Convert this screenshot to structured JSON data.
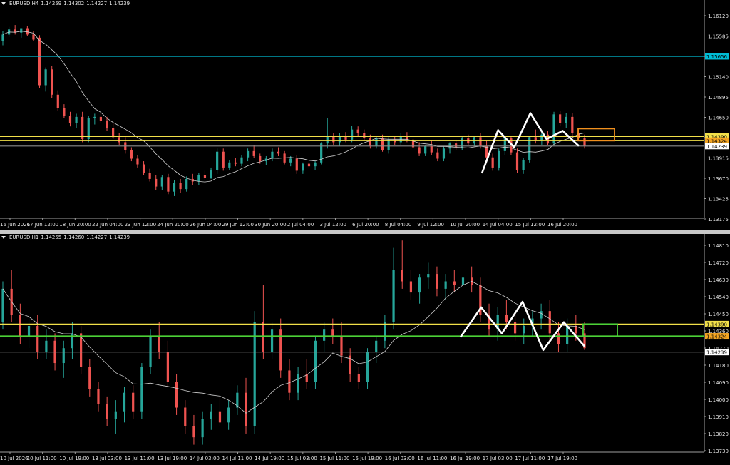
{
  "theme": {
    "background": "#000000",
    "bull": "#26a69a",
    "bear": "#ef5350",
    "ma": "#cfcfcf",
    "axis": "#9e9e9e",
    "text": "#e6e6e6"
  },
  "top": {
    "symbol": "EURUSD,H4",
    "ohlc": [
      "1.14259",
      "1.14302",
      "1.14227",
      "1.14239"
    ],
    "price_min": 1.131,
    "price_max": 1.165,
    "price_labels": [
      "1.16120",
      "1.15585",
      "1.15380",
      "1.15140",
      "1.14895",
      "1.14650",
      "1.14160",
      "1.13915",
      "1.13670",
      "1.13425",
      "1.13175"
    ],
    "time_labels": [
      "16 Jun 2026",
      "17 Jun 12:00",
      "18 Jun 20:00",
      "22 Jun 04:00",
      "23 Jun 12:00",
      "24 Jun 20:00",
      "26 Jun 04:00",
      "29 Jun 12:00",
      "30 Jun 20:00",
      "2 Jul 04:00",
      "3 Jul 12:00",
      "6 Jul 20:00",
      "8 Jul 04:00",
      "9 Jul 12:00",
      "10 Jul 20:00",
      "14 Jul 04:00",
      "15 Jul 12:00",
      "16 Jul 20:00"
    ],
    "hlines": [
      {
        "price": 1.15656,
        "color": "#00bcd4",
        "label": "1.15656",
        "tagColor": "#00bcd4"
      },
      {
        "price": 1.1439,
        "color": "#f2e04a",
        "label": "1.14390",
        "tagColor": "#f2e04a"
      },
      {
        "price": 1.14324,
        "color": "#f2e04a",
        "label": "1.14324",
        "tagColor": "#f5a623"
      },
      {
        "price": 1.14239,
        "color": "#8a8a8a",
        "label": "1.14239",
        "tagColor": "#ffffff"
      }
    ],
    "box": {
      "color": "#f0901e"
    },
    "zigzag": [
      1.1381,
      1.1449,
      1.1422,
      1.1476,
      1.1435,
      1.1448,
      1.1424
    ],
    "candles": [
      [
        1.159,
        1.1605,
        1.1583,
        1.16
      ],
      [
        1.16,
        1.1612,
        1.1596,
        1.1608
      ],
      [
        1.1608,
        1.1615,
        1.16,
        1.1603
      ],
      [
        1.1603,
        1.161,
        1.1595,
        1.161
      ],
      [
        1.161,
        1.1614,
        1.1598,
        1.16
      ],
      [
        1.16,
        1.1606,
        1.159,
        1.1592
      ],
      [
        1.1595,
        1.1599,
        1.1515,
        1.152
      ],
      [
        1.152,
        1.1548,
        1.151,
        1.1545
      ],
      [
        1.1545,
        1.155,
        1.15,
        1.1505
      ],
      [
        1.1505,
        1.1512,
        1.148,
        1.1484
      ],
      [
        1.1484,
        1.149,
        1.1468,
        1.1472
      ],
      [
        1.1472,
        1.1478,
        1.1455,
        1.146
      ],
      [
        1.146,
        1.1475,
        1.1452,
        1.147
      ],
      [
        1.147,
        1.1478,
        1.143,
        1.1435
      ],
      [
        1.1435,
        1.1472,
        1.143,
        1.1468
      ],
      [
        1.1468,
        1.1475,
        1.1458,
        1.147
      ],
      [
        1.147,
        1.1476,
        1.146,
        1.1464
      ],
      [
        1.1464,
        1.147,
        1.1448,
        1.1452
      ],
      [
        1.1452,
        1.146,
        1.1435,
        1.1438
      ],
      [
        1.1438,
        1.1445,
        1.1425,
        1.143
      ],
      [
        1.143,
        1.1438,
        1.1412,
        1.1418
      ],
      [
        1.1418,
        1.1422,
        1.14,
        1.1404
      ],
      [
        1.1404,
        1.141,
        1.139,
        1.1395
      ],
      [
        1.1395,
        1.14,
        1.1378,
        1.1382
      ],
      [
        1.1382,
        1.1388,
        1.1368,
        1.1372
      ],
      [
        1.1372,
        1.1378,
        1.1355,
        1.136
      ],
      [
        1.136,
        1.1378,
        1.1354,
        1.1375
      ],
      [
        1.1375,
        1.138,
        1.1348,
        1.1352
      ],
      [
        1.1352,
        1.137,
        1.1345,
        1.1366
      ],
      [
        1.1366,
        1.1372,
        1.135,
        1.1356
      ],
      [
        1.1356,
        1.1376,
        1.1352,
        1.1372
      ],
      [
        1.1372,
        1.138,
        1.1362,
        1.1368
      ],
      [
        1.1368,
        1.1382,
        1.1362,
        1.1378
      ],
      [
        1.1378,
        1.1385,
        1.137,
        1.1374
      ],
      [
        1.1374,
        1.139,
        1.1372,
        1.1386
      ],
      [
        1.1386,
        1.142,
        1.138,
        1.1415
      ],
      [
        1.1415,
        1.142,
        1.1385,
        1.139
      ],
      [
        1.139,
        1.1402,
        1.1386,
        1.1398
      ],
      [
        1.1398,
        1.1405,
        1.1392,
        1.1396
      ],
      [
        1.1396,
        1.141,
        1.1392,
        1.1406
      ],
      [
        1.1406,
        1.142,
        1.14,
        1.1416
      ],
      [
        1.1416,
        1.1425,
        1.1405,
        1.1408
      ],
      [
        1.1408,
        1.1412,
        1.1396,
        1.14
      ],
      [
        1.14,
        1.1408,
        1.1394,
        1.1404
      ],
      [
        1.1404,
        1.142,
        1.14,
        1.1415
      ],
      [
        1.1415,
        1.1422,
        1.1408,
        1.1412
      ],
      [
        1.1412,
        1.1416,
        1.1395,
        1.1398
      ],
      [
        1.1398,
        1.1408,
        1.1392,
        1.1404
      ],
      [
        1.1404,
        1.141,
        1.138,
        1.1385
      ],
      [
        1.1385,
        1.1398,
        1.138,
        1.1396
      ],
      [
        1.1396,
        1.1402,
        1.1388,
        1.1392
      ],
      [
        1.1392,
        1.14,
        1.1386,
        1.1398
      ],
      [
        1.1398,
        1.143,
        1.1395,
        1.1428
      ],
      [
        1.1428,
        1.1468,
        1.142,
        1.144
      ],
      [
        1.144,
        1.1445,
        1.1425,
        1.143
      ],
      [
        1.143,
        1.1444,
        1.1424,
        1.144
      ],
      [
        1.144,
        1.1446,
        1.143,
        1.1434
      ],
      [
        1.1434,
        1.1456,
        1.143,
        1.145
      ],
      [
        1.145,
        1.1455,
        1.144,
        1.1444
      ],
      [
        1.1444,
        1.145,
        1.1432,
        1.1436
      ],
      [
        1.1436,
        1.1442,
        1.142,
        1.1424
      ],
      [
        1.1424,
        1.144,
        1.142,
        1.1436
      ],
      [
        1.1436,
        1.1442,
        1.1415,
        1.1418
      ],
      [
        1.1418,
        1.1438,
        1.1412,
        1.1434
      ],
      [
        1.1434,
        1.144,
        1.1425,
        1.143
      ],
      [
        1.143,
        1.1445,
        1.1426,
        1.144
      ],
      [
        1.144,
        1.1446,
        1.143,
        1.1434
      ],
      [
        1.1434,
        1.1438,
        1.1418,
        1.1422
      ],
      [
        1.1422,
        1.143,
        1.1408,
        1.1412
      ],
      [
        1.1412,
        1.1426,
        1.1408,
        1.1424
      ],
      [
        1.1424,
        1.1432,
        1.141,
        1.1414
      ],
      [
        1.1414,
        1.142,
        1.14,
        1.1404
      ],
      [
        1.1404,
        1.1424,
        1.14,
        1.142
      ],
      [
        1.142,
        1.143,
        1.1412,
        1.1428
      ],
      [
        1.1428,
        1.1434,
        1.1418,
        1.1422
      ],
      [
        1.1422,
        1.144,
        1.1418,
        1.1436
      ],
      [
        1.1436,
        1.1442,
        1.1425,
        1.1428
      ],
      [
        1.1428,
        1.144,
        1.1424,
        1.1438
      ],
      [
        1.1438,
        1.1444,
        1.142,
        1.1424
      ],
      [
        1.1424,
        1.1432,
        1.1402,
        1.1406
      ],
      [
        1.1406,
        1.1412,
        1.1385,
        1.139
      ],
      [
        1.139,
        1.142,
        1.1385,
        1.1416
      ],
      [
        1.1416,
        1.1438,
        1.141,
        1.1436
      ],
      [
        1.1436,
        1.144,
        1.141,
        1.1414
      ],
      [
        1.1414,
        1.142,
        1.1382,
        1.1386
      ],
      [
        1.1386,
        1.1405,
        1.138,
        1.1402
      ],
      [
        1.1402,
        1.144,
        1.1398,
        1.1438
      ],
      [
        1.1438,
        1.145,
        1.1428,
        1.1432
      ],
      [
        1.1432,
        1.1445,
        1.1426,
        1.1442
      ],
      [
        1.1442,
        1.1448,
        1.1425,
        1.1428
      ],
      [
        1.1428,
        1.1478,
        1.1424,
        1.1474
      ],
      [
        1.1474,
        1.148,
        1.1455,
        1.146
      ],
      [
        1.146,
        1.1476,
        1.1452,
        1.147
      ],
      [
        1.147,
        1.1476,
        1.144,
        1.1444
      ],
      [
        1.1444,
        1.145,
        1.1432,
        1.1436
      ],
      [
        1.1436,
        1.1442,
        1.142,
        1.1424
      ]
    ]
  },
  "bottom": {
    "symbol": "EURUSD,H1",
    "ohlc": [
      "1.14255",
      "1.14260",
      "1.14227",
      "1.14239"
    ],
    "price_min": 1.137,
    "price_max": 1.1486,
    "price_labels": [
      "1.14810",
      "1.14720",
      "1.14630",
      "1.14540",
      "1.14450",
      "1.14360",
      "1.14270",
      "1.14180",
      "1.14090",
      "1.14000",
      "1.13910",
      "1.13820",
      "1.13730"
    ],
    "time_labels": [
      "10 Jul 2026",
      "10 Jul 11:00",
      "10 Jul 19:00",
      "13 Jul 03:00",
      "13 Jul 11:00",
      "13 Jul 19:00",
      "14 Jul 03:00",
      "14 Jul 11:00",
      "14 Jul 19:00",
      "15 Jul 03:00",
      "15 Jul 11:00",
      "15 Jul 19:00",
      "16 Jul 03:00",
      "16 Jul 11:00",
      "16 Jul 19:00",
      "17 Jul 03:00",
      "17 Jul 11:00",
      "17 Jul 19:00"
    ],
    "hlines": [
      {
        "price": 1.1439,
        "color": "#f2e04a",
        "label": "1.14390",
        "tagColor": "#f2e04a"
      },
      {
        "price": 1.14324,
        "color": "#f2e04a",
        "label": "1.14324",
        "tagColor": "#f5a623"
      },
      {
        "price": 1.14239,
        "color": "#8a8a8a",
        "label": "1.14239",
        "tagColor": "#ffffff"
      }
    ],
    "green_line": {
      "price": 1.14324,
      "color": "#4cd137"
    },
    "box": {
      "color": "#4cd137"
    },
    "zigzag": [
      1.1432,
      1.1448,
      1.1434,
      1.1451,
      1.1425,
      1.144,
      1.1427
    ],
    "candles": [
      [
        1.144,
        1.1462,
        1.1436,
        1.1458
      ],
      [
        1.1458,
        1.1468,
        1.144,
        1.1444
      ],
      [
        1.1444,
        1.145,
        1.1428,
        1.1432
      ],
      [
        1.1432,
        1.1442,
        1.1426,
        1.1438
      ],
      [
        1.1438,
        1.1444,
        1.142,
        1.1424
      ],
      [
        1.1424,
        1.1436,
        1.142,
        1.143
      ],
      [
        1.143,
        1.1434,
        1.1414,
        1.1418
      ],
      [
        1.1418,
        1.143,
        1.141,
        1.1426
      ],
      [
        1.1426,
        1.144,
        1.142,
        1.1434
      ],
      [
        1.1434,
        1.1438,
        1.1412,
        1.1416
      ],
      [
        1.1416,
        1.142,
        1.14,
        1.1404
      ],
      [
        1.1404,
        1.1408,
        1.1392,
        1.1396
      ],
      [
        1.1396,
        1.14,
        1.1384,
        1.1388
      ],
      [
        1.1388,
        1.1398,
        1.138,
        1.1392
      ],
      [
        1.1392,
        1.1405,
        1.1386,
        1.1402
      ],
      [
        1.1402,
        1.1406,
        1.1388,
        1.1392
      ],
      [
        1.1392,
        1.1418,
        1.1388,
        1.1416
      ],
      [
        1.1416,
        1.1436,
        1.1412,
        1.1432
      ],
      [
        1.1432,
        1.144,
        1.142,
        1.1424
      ],
      [
        1.1424,
        1.143,
        1.1405,
        1.1408
      ],
      [
        1.1408,
        1.1412,
        1.139,
        1.1394
      ],
      [
        1.1394,
        1.1398,
        1.138,
        1.1384
      ],
      [
        1.1384,
        1.139,
        1.1374,
        1.1378
      ],
      [
        1.1378,
        1.1392,
        1.1374,
        1.1388
      ],
      [
        1.1388,
        1.1396,
        1.1382,
        1.1392
      ],
      [
        1.1392,
        1.14,
        1.1384,
        1.1386
      ],
      [
        1.1386,
        1.1398,
        1.1382,
        1.1394
      ],
      [
        1.1394,
        1.1406,
        1.139,
        1.1402
      ],
      [
        1.1402,
        1.141,
        1.138,
        1.1384
      ],
      [
        1.1384,
        1.1446,
        1.138,
        1.144
      ],
      [
        1.144,
        1.146,
        1.142,
        1.1424
      ],
      [
        1.1424,
        1.144,
        1.142,
        1.1436
      ],
      [
        1.1436,
        1.1442,
        1.141,
        1.1414
      ],
      [
        1.1414,
        1.142,
        1.1398,
        1.1402
      ],
      [
        1.1402,
        1.1416,
        1.1398,
        1.1412
      ],
      [
        1.1412,
        1.142,
        1.1404,
        1.1408
      ],
      [
        1.1408,
        1.1432,
        1.1404,
        1.143
      ],
      [
        1.143,
        1.144,
        1.1424,
        1.1436
      ],
      [
        1.1436,
        1.1442,
        1.1428,
        1.1432
      ],
      [
        1.1432,
        1.144,
        1.1418,
        1.1422
      ],
      [
        1.1422,
        1.1426,
        1.1408,
        1.1412
      ],
      [
        1.1412,
        1.1416,
        1.1404,
        1.1408
      ],
      [
        1.1408,
        1.1426,
        1.1404,
        1.1424
      ],
      [
        1.1424,
        1.1432,
        1.1418,
        1.143
      ],
      [
        1.143,
        1.1444,
        1.1426,
        1.144
      ],
      [
        1.144,
        1.148,
        1.1436,
        1.1468
      ],
      [
        1.1468,
        1.1484,
        1.1458,
        1.1462
      ],
      [
        1.1462,
        1.1468,
        1.1452,
        1.1456
      ],
      [
        1.1456,
        1.1466,
        1.145,
        1.1464
      ],
      [
        1.1464,
        1.1472,
        1.1458,
        1.1466
      ],
      [
        1.1466,
        1.147,
        1.1454,
        1.1458
      ],
      [
        1.1458,
        1.1466,
        1.1452,
        1.1462
      ],
      [
        1.1462,
        1.1468,
        1.1456,
        1.146
      ],
      [
        1.146,
        1.1468,
        1.1455,
        1.1464
      ],
      [
        1.1464,
        1.147,
        1.1456,
        1.146
      ],
      [
        1.146,
        1.1464,
        1.144,
        1.1444
      ],
      [
        1.1444,
        1.145,
        1.1432,
        1.1436
      ],
      [
        1.1436,
        1.1448,
        1.143,
        1.1444
      ],
      [
        1.1444,
        1.1452,
        1.1436,
        1.144
      ],
      [
        1.144,
        1.1446,
        1.143,
        1.1434
      ],
      [
        1.1434,
        1.1442,
        1.1428,
        1.1438
      ],
      [
        1.1438,
        1.1446,
        1.1432,
        1.1442
      ],
      [
        1.1442,
        1.145,
        1.1436,
        1.1446
      ],
      [
        1.1446,
        1.1452,
        1.143,
        1.1434
      ],
      [
        1.1434,
        1.144,
        1.1424,
        1.1428
      ],
      [
        1.1428,
        1.1442,
        1.1424,
        1.1438
      ],
      [
        1.1438,
        1.1444,
        1.143,
        1.1434
      ],
      [
        1.1434,
        1.144,
        1.1425,
        1.1426
      ]
    ]
  }
}
